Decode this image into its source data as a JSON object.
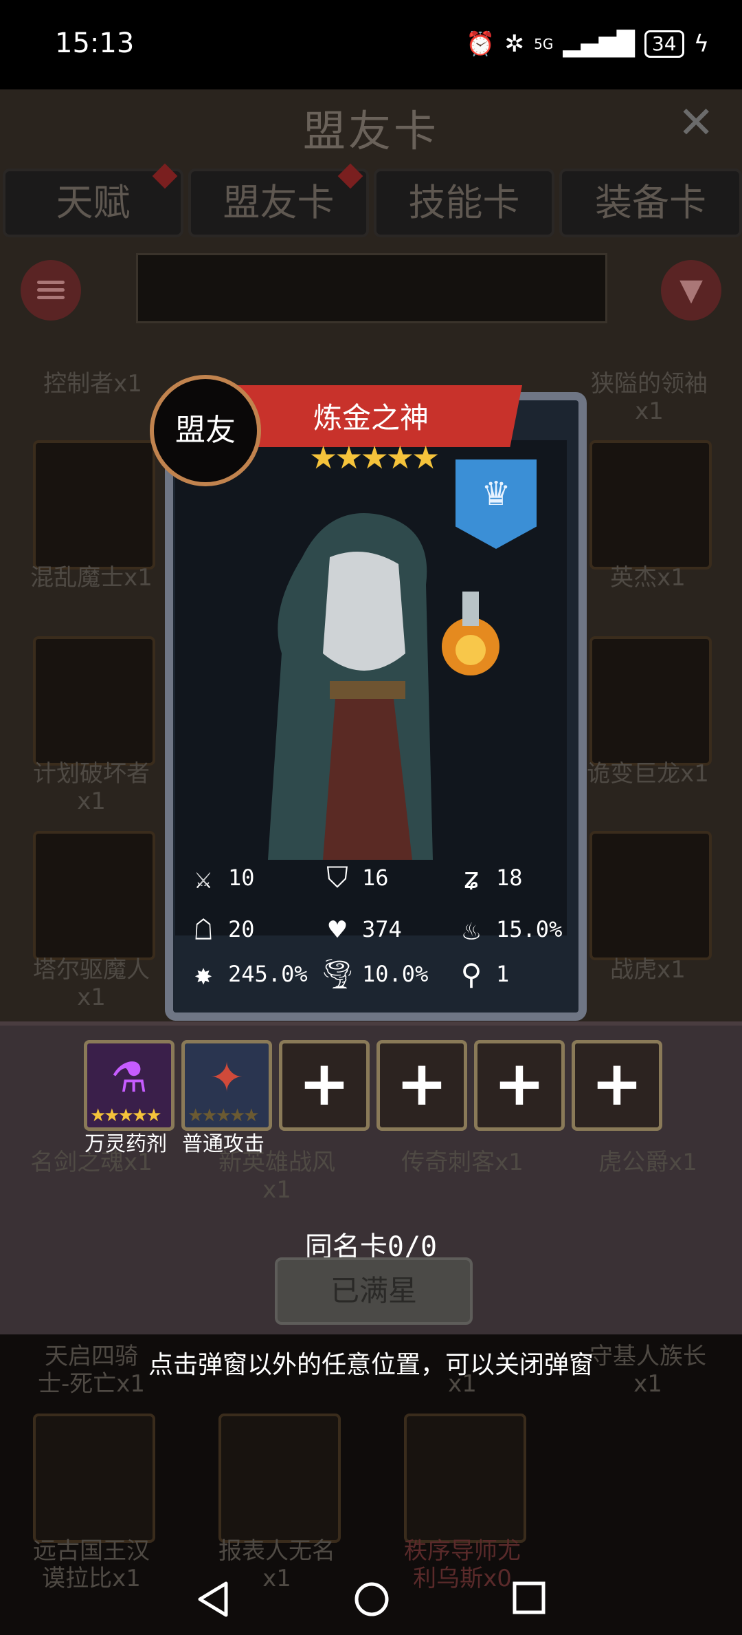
{
  "status_bar": {
    "time": "15:13",
    "network": "5G",
    "battery": "34"
  },
  "header": {
    "title": "盟友卡",
    "close_glyph": "✕"
  },
  "tabs": [
    {
      "label": "天赋",
      "has_dot": true
    },
    {
      "label": "盟友卡",
      "has_dot": true
    },
    {
      "label": "技能卡",
      "has_dot": false
    },
    {
      "label": "装备卡",
      "has_dot": false
    }
  ],
  "background_cards": [
    {
      "label": "控制者x1"
    },
    {
      "label": "狭隘的领袖\nx1"
    },
    {
      "label": "混乱魔士x1"
    },
    {
      "label": "英杰x1"
    },
    {
      "label": "计划破坏者\nx1"
    },
    {
      "label": "诡变巨龙x1"
    },
    {
      "label": "塔尔驱魔人\nx1"
    },
    {
      "label": "战虎x1"
    },
    {
      "label": "名剑之魂x1"
    },
    {
      "label": "新英雄战风\nx1"
    },
    {
      "label": "传奇刺客x1"
    },
    {
      "label": "虎公爵x1"
    },
    {
      "label": "天启四骑\n士-死亡x1"
    },
    {
      "label": "x1"
    },
    {
      "label": "守基人族长\nx1"
    },
    {
      "label": "远古国王汉\n谟拉比x1"
    },
    {
      "label": "报表人无名\nx1"
    },
    {
      "label": "秩序导师尤\n利乌斯x0"
    }
  ],
  "card": {
    "badge": "盟友",
    "name": "炼金之神",
    "stars": "★★★★★",
    "rank_icon": "crown-icon",
    "banner_color": "#c8322b",
    "flag_color": "#3b8fd6",
    "stats": [
      {
        "icon": "sword-icon",
        "glyph": "⚔",
        "value": "10"
      },
      {
        "icon": "shield-icon",
        "glyph": "⛉",
        "value": "16"
      },
      {
        "icon": "whirl-icon",
        "glyph": "ʑ",
        "value": "18"
      },
      {
        "icon": "hood-icon",
        "glyph": "☖",
        "value": "20"
      },
      {
        "icon": "heart-icon",
        "glyph": "♥",
        "value": "374"
      },
      {
        "icon": "flame-icon",
        "glyph": "♨",
        "value": "15.0%"
      },
      {
        "icon": "splash-icon",
        "glyph": "✸",
        "value": "245.0%"
      },
      {
        "icon": "tornado-icon",
        "glyph": "🌪",
        "value": "10.0%"
      },
      {
        "icon": "boot-icon",
        "glyph": "⚲",
        "value": "1"
      }
    ]
  },
  "skills": [
    {
      "label": "万灵药剂",
      "stars": "★★★★★",
      "icon": "potion-icon"
    },
    {
      "label": "普通攻击",
      "stars": "★★★★★",
      "icon": "mage-attack-icon"
    },
    {
      "label": "",
      "plus": "+"
    },
    {
      "label": "",
      "plus": "+"
    },
    {
      "label": "",
      "plus": "+"
    },
    {
      "label": "",
      "plus": "+"
    }
  ],
  "duplicate_text": "同名卡0/0",
  "maxed_button": "已满星",
  "hint": "点击弹窗以外的任意位置，可以关闭弹窗",
  "colors": {
    "star": "#f5c33b",
    "card_border": "#6f7685",
    "badge_border": "#c1834e"
  }
}
